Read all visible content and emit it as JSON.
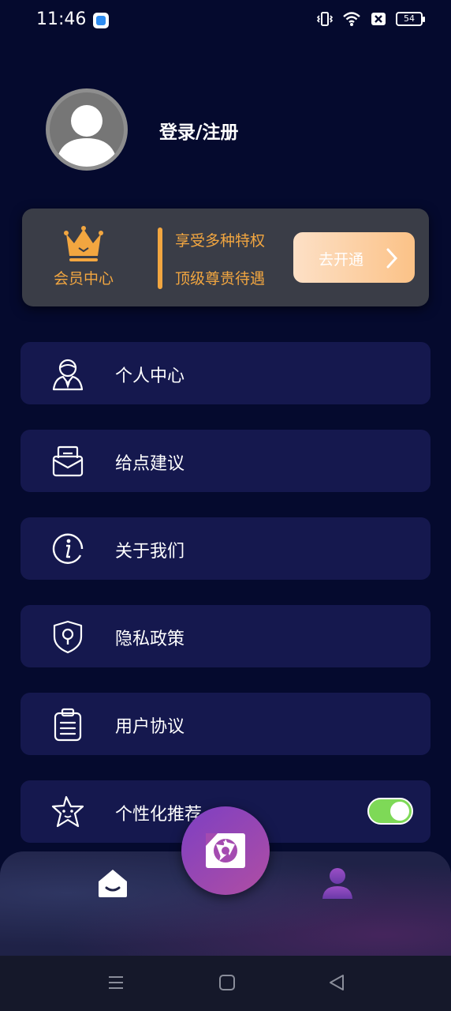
{
  "status_bar": {
    "time": "11:46",
    "battery": "54"
  },
  "profile": {
    "login_label": "登录/注册"
  },
  "vip": {
    "label": "会员中心",
    "line1": "享受多种特权",
    "line2": "顶级尊贵待遇",
    "button_label": "去开通",
    "accent_color": "#f2a640"
  },
  "menu": {
    "items": [
      {
        "label": "个人中心",
        "icon": "person-icon"
      },
      {
        "label": "给点建议",
        "icon": "mail-icon"
      },
      {
        "label": "关于我们",
        "icon": "info-icon"
      },
      {
        "label": "隐私政策",
        "icon": "shield-lock-icon"
      },
      {
        "label": "用户协议",
        "icon": "clipboard-icon"
      },
      {
        "label": "个性化推荐",
        "icon": "star-icon",
        "toggle_on": true
      }
    ]
  },
  "tab_bar": {
    "items": [
      "home-icon",
      "camera-icon",
      "profile-icon"
    ],
    "active": "home-icon"
  },
  "colors": {
    "background": "#050a2e",
    "card": "#15184e",
    "toggle": "#7ed957",
    "fab": "#9c47b3"
  }
}
